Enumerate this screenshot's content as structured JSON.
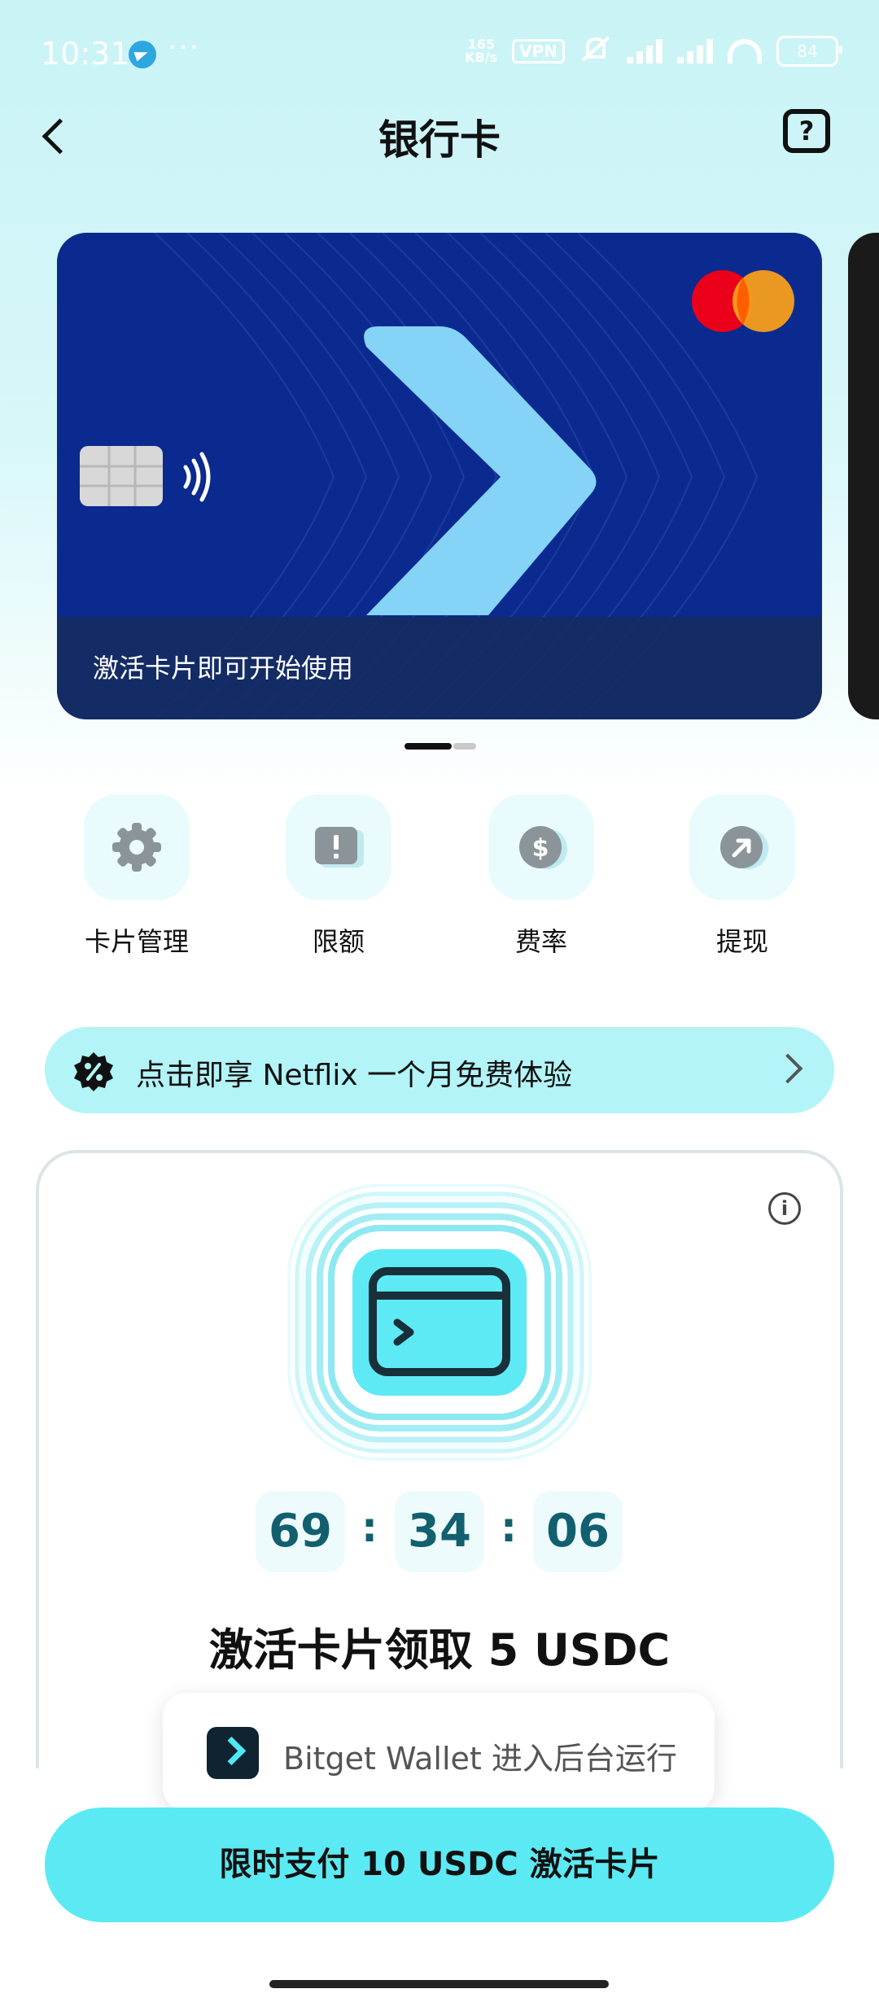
{
  "status_bar": {
    "time": "10:31",
    "dots": "···",
    "net_speed_top": "165",
    "net_speed_bottom": "KB/s",
    "vpn": "VPN",
    "battery": "84"
  },
  "header": {
    "title": "银行卡",
    "help_label": "?"
  },
  "card": {
    "overlay_text": "激活卡片即可开始使用",
    "brand_icon": "mastercard-logo",
    "active_page": 1,
    "page_count": 2
  },
  "quick_actions": [
    {
      "label": "卡片管理",
      "icon": "gear-icon"
    },
    {
      "label": "限额",
      "icon": "limit-icon"
    },
    {
      "label": "费率",
      "icon": "dollar-icon"
    },
    {
      "label": "提现",
      "icon": "withdraw-icon"
    }
  ],
  "promo": {
    "text": "点击即享 Netflix 一个月免费体验",
    "icon": "discount-badge-icon"
  },
  "activation": {
    "countdown": {
      "hours": "69",
      "minutes": "34",
      "seconds": "06",
      "separator": ":"
    },
    "title": "激活卡片领取  5 USDC",
    "info_label": "i"
  },
  "toast": {
    "text": "Bitget Wallet 进入后台运行"
  },
  "cta": {
    "label": "限时支付 10 USDC 激活卡片"
  },
  "colors": {
    "accent": "#5beaf3",
    "card_blue": "#0b2a8f",
    "countdown_text": "#12606f"
  }
}
